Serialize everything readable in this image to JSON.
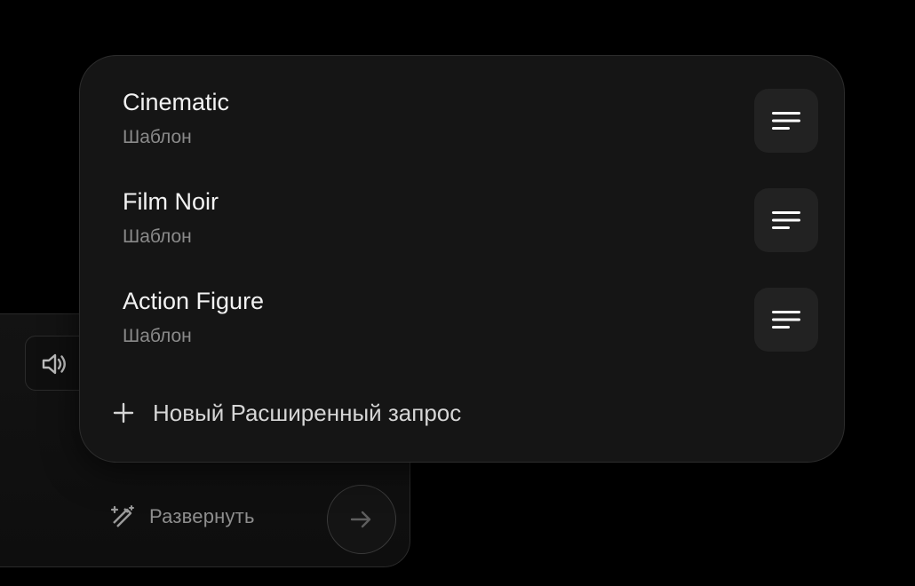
{
  "templates": [
    {
      "title": "Cinematic",
      "subtitle": "Шаблон",
      "menu_icon": "lines-icon"
    },
    {
      "title": "Film Noir",
      "subtitle": "Шаблон",
      "menu_icon": "lines-icon"
    },
    {
      "title": "Action Figure",
      "subtitle": "Шаблон",
      "menu_icon": "lines-icon"
    }
  ],
  "new_request": {
    "label": "Новый Расширенный запрос",
    "icon": "plus-icon"
  },
  "composer": {
    "expand_label": "Развернуть",
    "expand_icon": "magic-wand-icon",
    "audio_icon": "speaker-icon",
    "send_icon": "arrow-right-icon"
  },
  "colors": {
    "background": "#000000",
    "panel": "#151515",
    "menu_button": "#222222",
    "title_text": "#f2f2f2",
    "subtitle_text": "#8a8a8a"
  }
}
